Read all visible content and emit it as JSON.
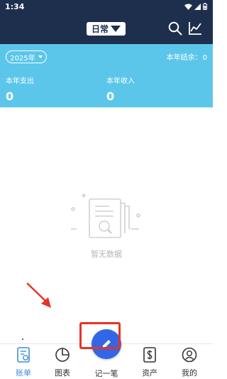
{
  "status_bar": {
    "time": "1:34"
  },
  "header": {
    "book_label": "日常",
    "icons": [
      "search-icon",
      "trend-icon",
      "chevron-down-icon"
    ]
  },
  "summary": {
    "year": "2025年",
    "balance_label": "本年结余：",
    "balance_value": "0",
    "expense_label": "本年支出",
    "expense_value": "0",
    "income_label": "本年收入",
    "income_value": "0"
  },
  "empty_state": {
    "text": "暂无数据"
  },
  "tabs": [
    {
      "label": "账单",
      "icon": "ledger-icon",
      "active": true
    },
    {
      "label": "图表",
      "icon": "pie-chart-icon",
      "active": false
    },
    {
      "label": "记一笔",
      "icon": "pencil-icon",
      "active": false
    },
    {
      "label": "资产",
      "icon": "dollar-icon",
      "active": false
    },
    {
      "label": "我的",
      "icon": "user-icon",
      "active": false
    }
  ],
  "colors": {
    "header": "#1e2e4d",
    "summary": "#5cc6ea",
    "fab": "#3366e6",
    "active_tab": "#3d8fd9",
    "annotation": "#e53424"
  }
}
